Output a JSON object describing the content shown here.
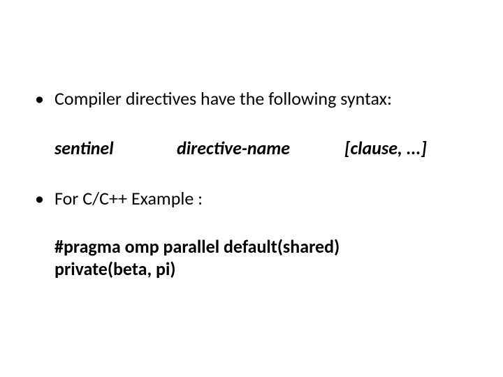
{
  "bullets": {
    "b1": "Compiler directives have the following syntax:",
    "b2": "For C/C++ Example :"
  },
  "syntax": {
    "sentinel": "sentinel",
    "directive": "directive-name",
    "clause": "[clause, ...]"
  },
  "code": {
    "line1": "#pragma  omp  parallel  default(shared)",
    "line2": "private(beta, pi)"
  }
}
